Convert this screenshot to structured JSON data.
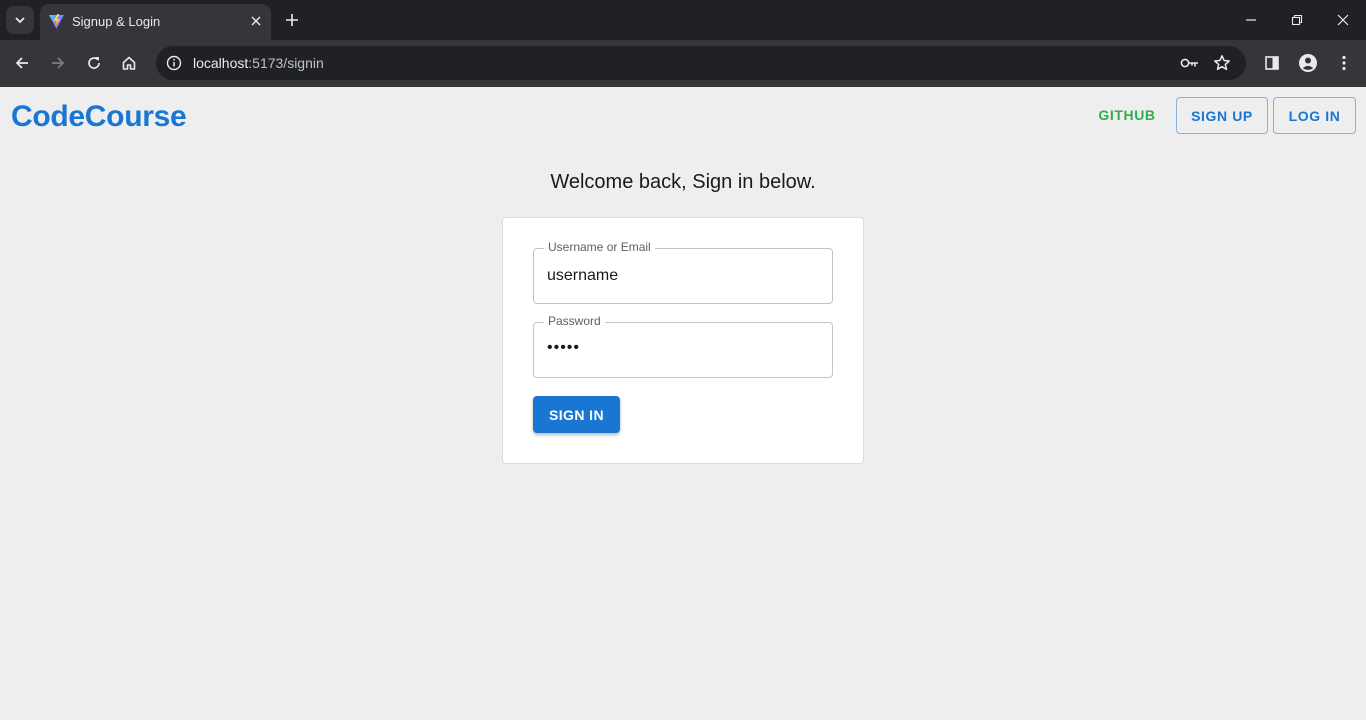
{
  "browser": {
    "tab": {
      "title": "Signup & Login",
      "favicon": "vite-logo-icon"
    },
    "address": {
      "host": "localhost",
      "path": ":5173/signin"
    }
  },
  "header": {
    "brand": "CodeCourse",
    "nav": {
      "github": "GITHUB",
      "signup": "SIGN UP",
      "login": "LOG IN"
    }
  },
  "main": {
    "heading": "Welcome back, Sign in below.",
    "form": {
      "username_label": "Username or Email",
      "username_value": "username",
      "password_label": "Password",
      "password_value": "•••••",
      "submit_label": "SIGN IN"
    }
  },
  "colors": {
    "primary": "#1976d2",
    "github": "#2eaf4a",
    "page_bg": "#eeeeee"
  }
}
